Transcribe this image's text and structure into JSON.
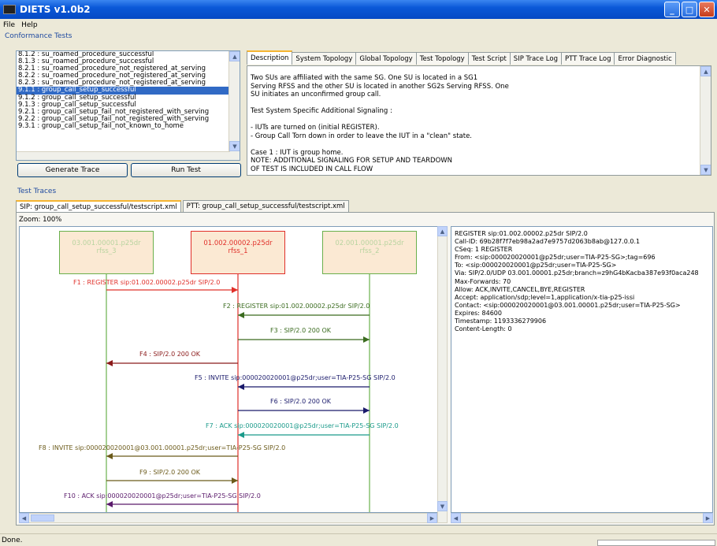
{
  "window": {
    "title": "DIETS v1.0b2"
  },
  "menu": [
    "File",
    "Help"
  ],
  "conformance": {
    "label": "Conformance Tests",
    "tests": [
      "8.1.2 : su_roamed_procedure_successful",
      "8.1.3 : su_roamed_procedure_successful",
      "8.2.1 : su_roamed_procedure_not_registered_at_serving",
      "8.2.2 : su_roamed_procedure_not_registered_at_serving",
      "8.2.3 : su_roamed_procedure_not_registered_at_serving",
      "9.1.1 : group_call_setup_successful",
      "9.1.2 : group_call_setup_successful",
      "9.1.3 : group_call_setup_successful",
      "9.2.1 : group_call_setup_fail_not_registered_with_serving",
      "9.2.2 : group_call_setup_fail_not_registered_with_serving",
      "9.3.1 : group_call_setup_fail_not_known_to_home"
    ],
    "selected_index": 5,
    "generate_trace": "Generate Trace",
    "run_test": "Run Test"
  },
  "detail_tabs": [
    "Description",
    "System Topology",
    "Global Topology",
    "Test Topology",
    "Test Script",
    "SIP Trace Log",
    "PTT Trace Log",
    "Error Diagnostic"
  ],
  "description_lines": [
    "Two SUs are affiliated with the same SG. One SU is located in a SG1",
    "Serving RFSS and the other SU is located in another SG2s Serving RFSS. One",
    "SU initiates an unconfirmed group call.",
    "",
    "Test System Specific Additional Signaling :",
    "",
    "- IUTs are turned on (initial REGISTER).",
    "- Group Call Torn down in order to leave the IUT in a \"clean\" state.",
    "",
    "Case 1 : IUT is group home.",
    "NOTE: ADDITIONAL SIGNALING FOR SETUP AND TEARDOWN",
    "OF TEST IS INCLUDED IN CALL FLOW"
  ],
  "traces": {
    "label": "Test Traces",
    "tabs": [
      "SIP: group_call_setup_successful/testscript.xml",
      "PTT: group_call_setup_successful/testscript.xml"
    ],
    "zoom": "Zoom: 100%"
  },
  "lifelines": [
    {
      "id": "03.001.00001.p25dr",
      "name": "rfss_3",
      "color": "#6ab04c",
      "fill": "#fbe9d3"
    },
    {
      "id": "01.002.00002.p25dr",
      "name": "rfss_1",
      "color": "#e0302a",
      "fill": "#fbe9d3"
    },
    {
      "id": "02.001.00001.p25dr",
      "name": "rfss_2",
      "color": "#6ab04c",
      "fill": "#fbe9d3"
    }
  ],
  "messages": [
    {
      "label": "F1 : REGISTER sip:01.002.00002.p25dr SIP/2.0",
      "color": "#e0302a"
    },
    {
      "label": "F2 : REGISTER sip:01.002.00002.p25dr SIP/2.0",
      "color": "#3a6b1f"
    },
    {
      "label": "F3 : SIP/2.0 200 OK",
      "color": "#3a6b1f"
    },
    {
      "label": "F4 : SIP/2.0 200 OK",
      "color": "#8b1a1a"
    },
    {
      "label": "F5 : INVITE sip:000020020001@p25dr;user=TIA-P25-SG SIP/2.0",
      "color": "#1a1a6b"
    },
    {
      "label": "F6 : SIP/2.0 200 OK",
      "color": "#1a1a6b"
    },
    {
      "label": "F7 : ACK sip:000020020001@p25dr;user=TIA-P25-SG SIP/2.0",
      "color": "#1a9a8a"
    },
    {
      "label": "F8 : INVITE sip:000020020001@03.001.00001.p25dr;user=TIA-P25-SG SIP/2.0",
      "color": "#6b5a1a"
    },
    {
      "label": "F9 : SIP/2.0 200 OK",
      "color": "#6b5a1a"
    },
    {
      "label": "F10 : ACK sip:000020020001@p25dr;user=TIA-P25-SG SIP/2.0",
      "color": "#5a1a6b"
    }
  ],
  "message_detail": [
    "REGISTER sip:01.002.00002.p25dr SIP/2.0",
    "Call-ID: 69b28f7f7eb98a2ad7e9757d2063b8ab@127.0.0.1",
    "CSeq: 1 REGISTER",
    "From: <sip:000020020001@p25dr;user=TIA-P25-SG>;tag=696",
    "To: <sip:000020020001@p25dr;user=TIA-P25-SG>",
    "Via: SIP/2.0/UDP 03.001.00001.p25dr;branch=z9hG4bKacba387e93f0aca248",
    "Max-Forwards: 70",
    "Allow: ACK,INVITE,CANCEL,BYE,REGISTER",
    "Accept: application/sdp;level=1,application/x-tia-p25-issi",
    "Contact: <sip:000020020001@03.001.00001.p25dr;user=TIA-P25-SG>",
    "Expires: 84600",
    "Timestamp: 1193336279906",
    "Content-Length: 0"
  ],
  "status": "Done."
}
